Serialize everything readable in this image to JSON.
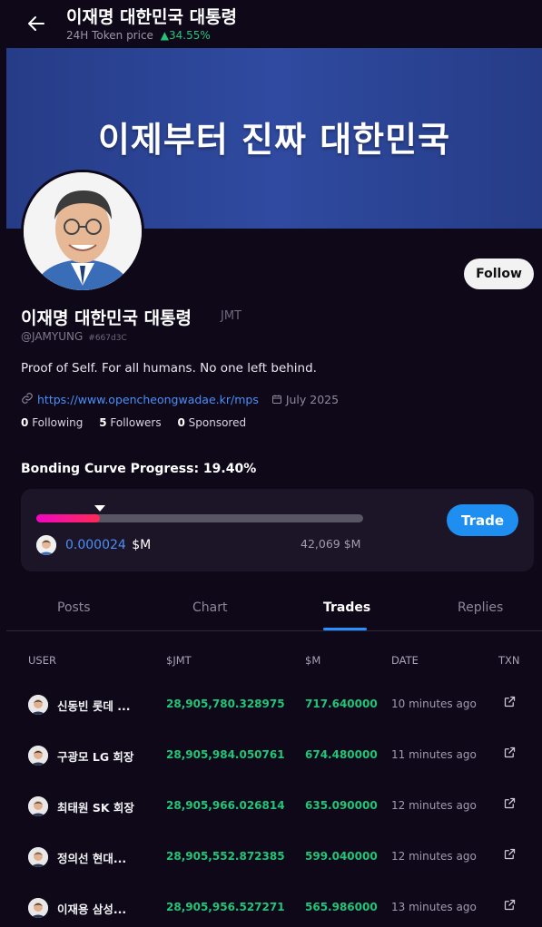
{
  "header": {
    "title": "이재명 대한민국 대통령",
    "subtitle_label": "24H Token price",
    "price_change": "34.55%",
    "price_change_color": "#22c578"
  },
  "banner": {
    "text": "이제부터 진짜 대한민국"
  },
  "profile": {
    "name": "이재명 대한민국 대통령",
    "ticker": "JMT",
    "handle": "@JAMYUNG",
    "hex_id": "#667d3C",
    "bio": "Proof of Self. For all humans. No one left behind.",
    "link": "https://www.opencheongwadae.kr/mps",
    "joined": "July 2025",
    "follow_label": "Follow",
    "stats": {
      "following_count": "0",
      "following_label": "Following",
      "followers_count": "5",
      "followers_label": "Followers",
      "sponsored_count": "0",
      "sponsored_label": "Sponsored"
    }
  },
  "bonding": {
    "title": "Bonding Curve Progress: 19.40%",
    "progress_fraction": 0.194,
    "price": "0.000024",
    "price_unit": "$M",
    "market_cap": "42,069 $M",
    "trade_label": "Trade"
  },
  "tabs": [
    {
      "label": "Posts",
      "active": false
    },
    {
      "label": "Chart",
      "active": false
    },
    {
      "label": "Trades",
      "active": true
    },
    {
      "label": "Replies",
      "active": false
    }
  ],
  "table": {
    "headers": {
      "user": "USER",
      "jmt": "$JMT",
      "m": "$M",
      "date": "DATE",
      "txn": "TXN"
    },
    "rows": [
      {
        "user": "신동빈 롯데 ...",
        "jmt": "28,905,780.328975",
        "m": "717.640000",
        "date": "10 minutes ago"
      },
      {
        "user": "구광모 LG 회장",
        "jmt": "28,905,984.050761",
        "m": "674.480000",
        "date": "11 minutes ago"
      },
      {
        "user": "최태원 SK 회장",
        "jmt": "28,905,966.026814",
        "m": "635.090000",
        "date": "12 minutes ago"
      },
      {
        "user": "정의선 현대...",
        "jmt": "28,905,552.872385",
        "m": "599.040000",
        "date": "12 minutes ago"
      },
      {
        "user": "이재용 삼성...",
        "jmt": "28,905,956.527271",
        "m": "565.986000",
        "date": "13 minutes ago"
      }
    ]
  },
  "icons": {
    "back": "arrow-left-icon",
    "link": "link-icon",
    "calendar": "calendar-icon",
    "external": "external-link-icon"
  }
}
